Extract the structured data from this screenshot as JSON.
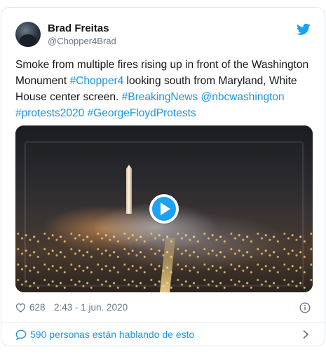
{
  "author": {
    "name": "Brad Freitas",
    "handle": "@Chopper4Brad"
  },
  "tweet": {
    "text_1": "Smoke from multiple fires rising up in front of the Washington Monument ",
    "tag_1": "#Chopper4",
    "text_2": " looking south from Maryland, White House center screen.  ",
    "tag_2": "#BreakingNews",
    "text_3": " ",
    "tag_3": "@nbcwashington",
    "text_4": " ",
    "tag_4": "#protests2020",
    "text_5": " ",
    "tag_5": "#GeorgeFloydProtests"
  },
  "media": {
    "type": "video",
    "play_icon": "play-icon"
  },
  "meta": {
    "likes": "628",
    "timestamp": "2:43 - 1 jun. 2020"
  },
  "conversation": {
    "label": "590 personas están hablando de esto"
  },
  "colors": {
    "accent": "#1b95e0",
    "play": "#1da1f2",
    "muted": "#657786",
    "text": "#14171a",
    "border": "#e1e8ed"
  }
}
